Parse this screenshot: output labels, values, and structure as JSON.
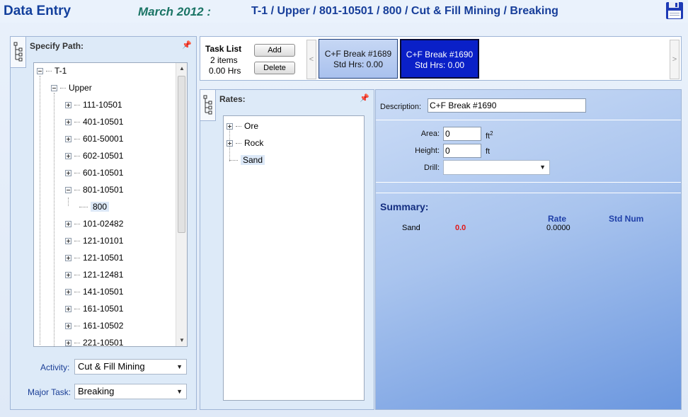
{
  "header": {
    "title": "Data Entry",
    "period": "March 2012 :",
    "breadcrumb": "T-1 / Upper / 801-10501 / 800 / Cut & Fill Mining / Breaking"
  },
  "path_panel": {
    "title": "Specify Path:",
    "tree": [
      {
        "label": "T-1",
        "state": "expanded",
        "level": 0
      },
      {
        "label": "Upper",
        "state": "expanded",
        "level": 1
      },
      {
        "label": "111-10501",
        "state": "collapsed",
        "level": 2
      },
      {
        "label": "401-10501",
        "state": "collapsed",
        "level": 2
      },
      {
        "label": "601-50001",
        "state": "collapsed",
        "level": 2
      },
      {
        "label": "602-10501",
        "state": "collapsed",
        "level": 2
      },
      {
        "label": "601-10501",
        "state": "collapsed",
        "level": 2
      },
      {
        "label": "801-10501",
        "state": "expanded",
        "level": 2
      },
      {
        "label": "800",
        "state": "leaf",
        "level": 3,
        "selected": true
      },
      {
        "label": "101-02482",
        "state": "collapsed",
        "level": 2
      },
      {
        "label": "121-10101",
        "state": "collapsed",
        "level": 2
      },
      {
        "label": "121-10501",
        "state": "collapsed",
        "level": 2
      },
      {
        "label": "121-12481",
        "state": "collapsed",
        "level": 2
      },
      {
        "label": "141-10501",
        "state": "collapsed",
        "level": 2
      },
      {
        "label": "161-10501",
        "state": "collapsed",
        "level": 2
      },
      {
        "label": "161-10502",
        "state": "collapsed",
        "level": 2
      },
      {
        "label": "221-10501",
        "state": "collapsed",
        "level": 2
      }
    ],
    "activity_label": "Activity:",
    "activity_value": "Cut & Fill Mining",
    "major_task_label": "Major Task:",
    "major_task_value": "Breaking"
  },
  "task_list": {
    "title": "Task List",
    "count": "2 items",
    "hours": "0.00 Hrs",
    "add_label": "Add",
    "delete_label": "Delete",
    "prev_label": "<",
    "next_label": ">",
    "tasks": [
      {
        "name": "C+F Break #1689",
        "hours": "Std Hrs: 0.00",
        "active": false
      },
      {
        "name": "C+F Break #1690",
        "hours": "Std Hrs: 0.00",
        "active": true
      }
    ]
  },
  "rates_panel": {
    "title": "Rates:",
    "items": [
      {
        "label": "Ore",
        "state": "collapsed"
      },
      {
        "label": "Rock",
        "state": "collapsed"
      },
      {
        "label": "Sand",
        "state": "leaf",
        "selected": true
      }
    ]
  },
  "detail": {
    "description_label": "Description:",
    "description_value": "C+F Break #1690",
    "area_label": "Area:",
    "area_value": "0",
    "area_unit": "ft",
    "area_unit_sup": "2",
    "height_label": "Height:",
    "height_value": "0",
    "height_unit": "ft",
    "drill_label": "Drill:",
    "drill_value": ""
  },
  "summary": {
    "title": "Summary:",
    "rate_header": "Rate",
    "std_num_header": "Std Num",
    "rows": [
      {
        "name": "Sand",
        "value": "0.0",
        "rate": "0.0000"
      }
    ]
  },
  "colors": {
    "title_blue": "#123f9c",
    "period_green": "#1a7465",
    "active_task": "#0a20c8",
    "summary_value_red": "#e01818"
  }
}
